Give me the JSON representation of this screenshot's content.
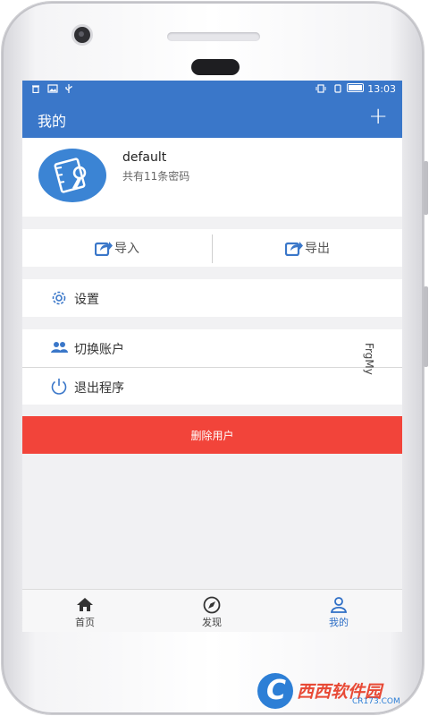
{
  "status_bar": {
    "left_icons": [
      "trash-icon",
      "image-icon",
      "usb-icon"
    ],
    "time": "13:03"
  },
  "app_bar": {
    "title": "我的",
    "add_label": "+"
  },
  "profile": {
    "name": "default",
    "subtitle": "共有11条密码"
  },
  "io": {
    "import_label": "导入",
    "export_label": "导出"
  },
  "menu": {
    "settings_label": "设置",
    "switch_account_label": "切换账户",
    "exit_label": "退出程序"
  },
  "side_text": "FrgMy",
  "delete_label": "删除用户",
  "bottom_nav": [
    {
      "label": "首页",
      "icon": "home-icon",
      "active": false
    },
    {
      "label": "发现",
      "icon": "compass-icon",
      "active": false
    },
    {
      "label": "我的",
      "icon": "person-icon",
      "active": true
    }
  ],
  "watermark": {
    "brand": "西西软件园",
    "site": "CR173.COM"
  },
  "colors": {
    "primary": "#3a77c9",
    "danger": "#f2443a",
    "active_tab": "#2f6fc6"
  }
}
